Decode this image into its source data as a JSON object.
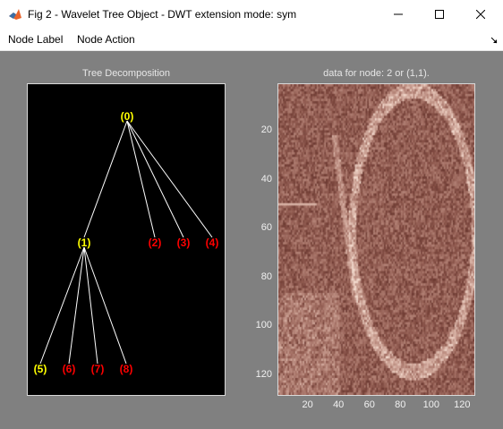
{
  "window": {
    "title": "Fig 2 - Wavelet Tree Object - DWT extension mode: sym",
    "buttons": [
      "minimize",
      "maximize",
      "close"
    ]
  },
  "menu": {
    "items": [
      {
        "label": "Node Label"
      },
      {
        "label": "Node Action"
      }
    ]
  },
  "tree_axes": {
    "title": "Tree Decomposition",
    "nodes": [
      {
        "label": "(0)",
        "color": "#ffff00"
      },
      {
        "label": "(1)",
        "color": "#ffff00"
      },
      {
        "label": "(2)",
        "color": "#ff0000"
      },
      {
        "label": "(3)",
        "color": "#ff0000"
      },
      {
        "label": "(4)",
        "color": "#ff0000"
      },
      {
        "label": "(5)",
        "color": "#ffff00"
      },
      {
        "label": "(6)",
        "color": "#ff0000"
      },
      {
        "label": "(7)",
        "color": "#ff0000"
      },
      {
        "label": "(8)",
        "color": "#ff0000"
      }
    ]
  },
  "image_axes": {
    "title": "data for node: 2 or (1,1).",
    "x_ticks": [
      "20",
      "40",
      "60",
      "80",
      "100",
      "120"
    ],
    "y_ticks": [
      "20",
      "40",
      "60",
      "80",
      "100",
      "120"
    ],
    "xlim": [
      1,
      128
    ],
    "ylim": [
      1,
      128
    ],
    "colormap": "pink"
  },
  "colors": {
    "figure_bg": "#808080",
    "tree_bg": "#000000",
    "root_label": "#ffff00",
    "leaf_label": "#ff0000"
  }
}
